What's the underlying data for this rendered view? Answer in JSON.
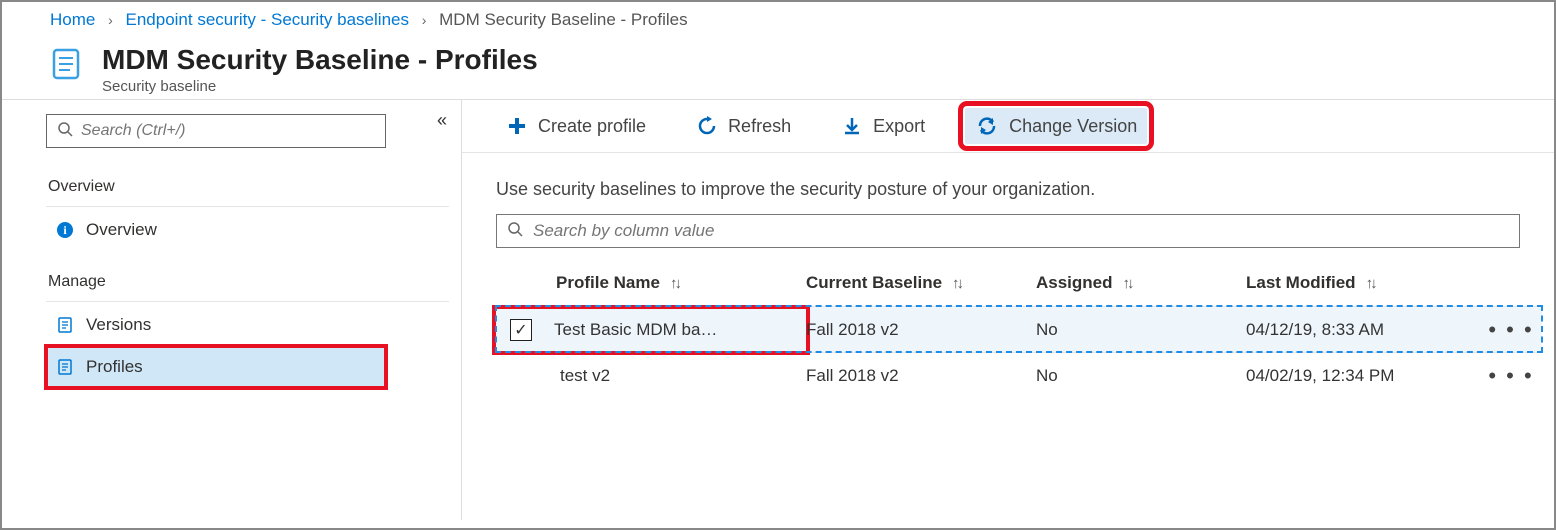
{
  "breadcrumb": {
    "home": "Home",
    "section": "Endpoint security - Security baselines",
    "current": "MDM Security Baseline - Profiles"
  },
  "header": {
    "title": "MDM Security Baseline - Profiles",
    "subtitle": "Security baseline"
  },
  "sidebar": {
    "search_placeholder": "Search (Ctrl+/)",
    "overview_section": "Overview",
    "overview_item": "Overview",
    "manage_section": "Manage",
    "versions_item": "Versions",
    "profiles_item": "Profiles"
  },
  "toolbar": {
    "create": "Create profile",
    "refresh": "Refresh",
    "export": "Export",
    "change_version": "Change Version"
  },
  "main": {
    "intro": "Use security baselines to improve the security posture of your organization.",
    "column_search_placeholder": "Search by column value"
  },
  "table": {
    "headers": {
      "profile_name": "Profile Name",
      "current_baseline": "Current Baseline",
      "assigned": "Assigned",
      "last_modified": "Last Modified"
    },
    "rows": [
      {
        "checked": true,
        "name": "Test Basic MDM ba…",
        "baseline": "Fall 2018 v2",
        "assigned": "No",
        "modified": "04/12/19, 8:33 AM"
      },
      {
        "checked": false,
        "name": "test v2",
        "baseline": "Fall 2018 v2",
        "assigned": "No",
        "modified": "04/02/19, 12:34 PM"
      }
    ]
  }
}
